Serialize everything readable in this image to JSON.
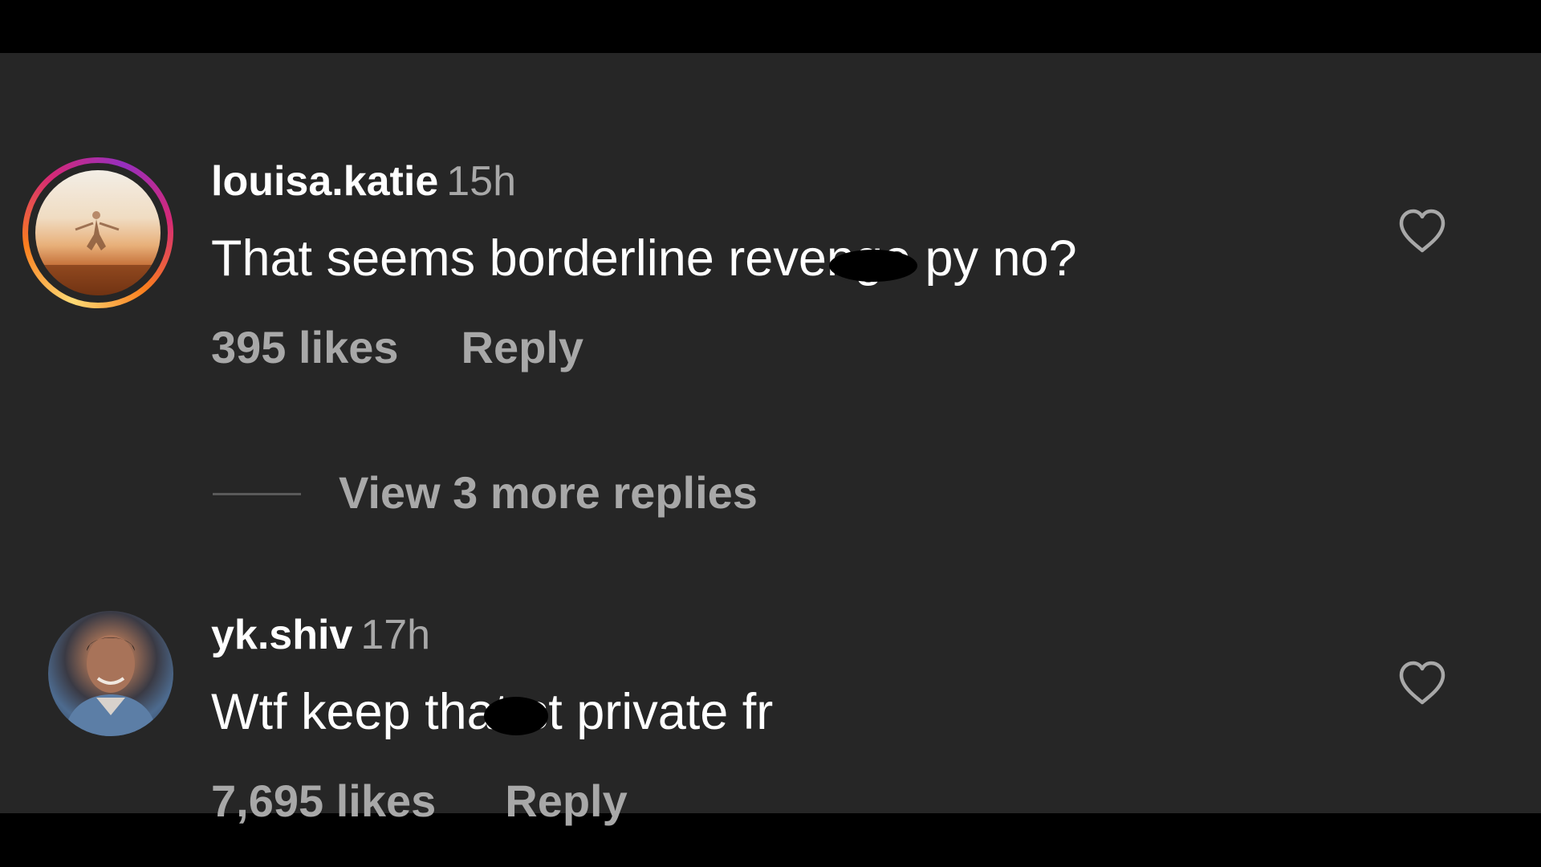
{
  "comments": [
    {
      "username": "louisa.katie",
      "time": "15h",
      "text_before": "That seems borderline revenge p",
      "text_after": "y no?",
      "likes": "395 likes",
      "reply_label": "Reply",
      "has_story_ring": true
    },
    {
      "username": "yk.shiv",
      "time": "17h",
      "text_before": "Wtf keep that s",
      "text_after": "t private fr",
      "likes": "7,695 likes",
      "reply_label": "Reply",
      "has_story_ring": false
    }
  ],
  "view_more_replies": "View 3 more replies",
  "icons": {
    "like": "heart-outline-icon"
  },
  "colors": {
    "background": "#262626",
    "primary_text": "#ffffff",
    "secondary_text": "#a8a8a8"
  }
}
